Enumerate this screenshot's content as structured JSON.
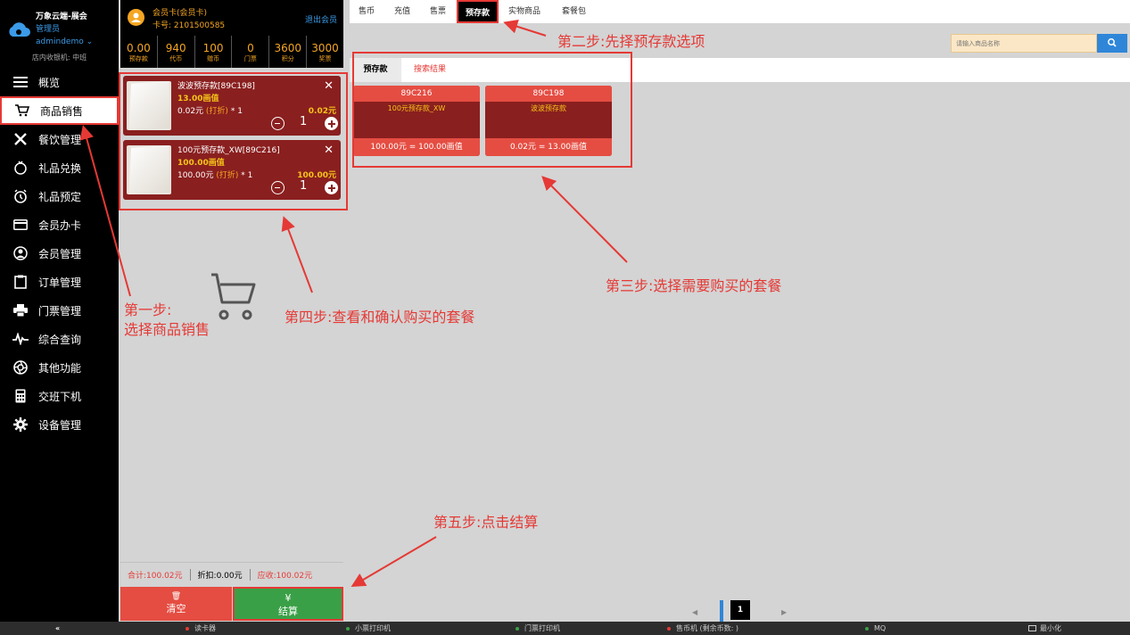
{
  "sidebar": {
    "brand": "万象云端-展会",
    "role": "管理员",
    "user": "admindemo ⌄",
    "terminal": "店内收银机: 中班",
    "items": [
      {
        "label": "概览",
        "icon": "menu-icon"
      },
      {
        "label": "商品销售",
        "icon": "cart-icon"
      },
      {
        "label": "餐饮管理",
        "icon": "utensils-icon"
      },
      {
        "label": "礼品兑换",
        "icon": "gift-icon"
      },
      {
        "label": "礼品预定",
        "icon": "clock-icon"
      },
      {
        "label": "会员办卡",
        "icon": "card-icon"
      },
      {
        "label": "会员管理",
        "icon": "user-circle-icon"
      },
      {
        "label": "订单管理",
        "icon": "clipboard-icon"
      },
      {
        "label": "门票管理",
        "icon": "printer-icon"
      },
      {
        "label": "综合查询",
        "icon": "pulse-icon"
      },
      {
        "label": "其他功能",
        "icon": "aperture-icon"
      },
      {
        "label": "交班下机",
        "icon": "calculator-icon"
      },
      {
        "label": "设备管理",
        "icon": "gear-icon"
      }
    ]
  },
  "member": {
    "name": "会员卡(会员卡)",
    "card": "卡号: 2101500585",
    "exit": "退出会员",
    "stats": [
      {
        "value": "0.00",
        "label": "预存款"
      },
      {
        "value": "940",
        "label": "代币"
      },
      {
        "value": "100",
        "label": "赠币"
      },
      {
        "value": "0",
        "label": "门票"
      },
      {
        "value": "3600",
        "label": "积分"
      },
      {
        "value": "3000",
        "label": "奖票"
      }
    ]
  },
  "cart": {
    "items": [
      {
        "name": "波波预存款[89C198]",
        "coin": "13.00画值",
        "price": "0.02元",
        "discount": "(打折)",
        "mult": "* 1",
        "total": "0.02元",
        "qty": "1"
      },
      {
        "name": "100元预存款_XW[89C216]",
        "coin": "100.00画值",
        "price": "100.00元",
        "discount": "(打折)",
        "mult": "* 1",
        "total": "100.00元",
        "qty": "1"
      }
    ],
    "summary": {
      "total": "合计:100.02元",
      "discount": "折扣:0.00元",
      "due": "应收:100.02元"
    },
    "clear_icon": "🗑",
    "clear_label": "清空",
    "pay_icon": "¥",
    "pay_label": "结算"
  },
  "tabs": [
    "售币",
    "充值",
    "售票",
    "预存款",
    "实物商品",
    "套餐包"
  ],
  "active_tab": "预存款",
  "search": {
    "placeholder": "请输入商品名称"
  },
  "sub_tabs": [
    "预存款",
    "搜索结果"
  ],
  "products": [
    {
      "code": "89C216",
      "name": "100元预存款_XW",
      "value": "100.00元 = 100.00画值"
    },
    {
      "code": "89C198",
      "name": "波波预存款",
      "value": "0.02元 = 13.00画值"
    }
  ],
  "pager": {
    "page": "1",
    "prev": "◀",
    "next": "▶"
  },
  "statusbar": {
    "collapse": "«",
    "items": [
      {
        "label": "读卡器",
        "color": "#e53935"
      },
      {
        "label": "小票打印机",
        "color": "#3aa047"
      },
      {
        "label": "门票打印机",
        "color": "#3aa047"
      },
      {
        "label": "售币机 (剩余币数: )",
        "color": "#e53935"
      },
      {
        "label": "MQ",
        "color": "#3aa047"
      }
    ],
    "minimize": "最小化"
  },
  "annotations": {
    "step1": "第一步:\n选择商品销售",
    "step2": "第二步:先择预存款选项",
    "step3": "第三步:选择需要购买的套餐",
    "step4": "第四步:查看和确认购买的套餐",
    "step5": "第五步:点击结算"
  },
  "colors": {
    "accent_red": "#e53935",
    "orange": "#f5a623",
    "blue": "#2f86d9",
    "green": "#3aa047",
    "card_dark": "#8a1f1f"
  }
}
